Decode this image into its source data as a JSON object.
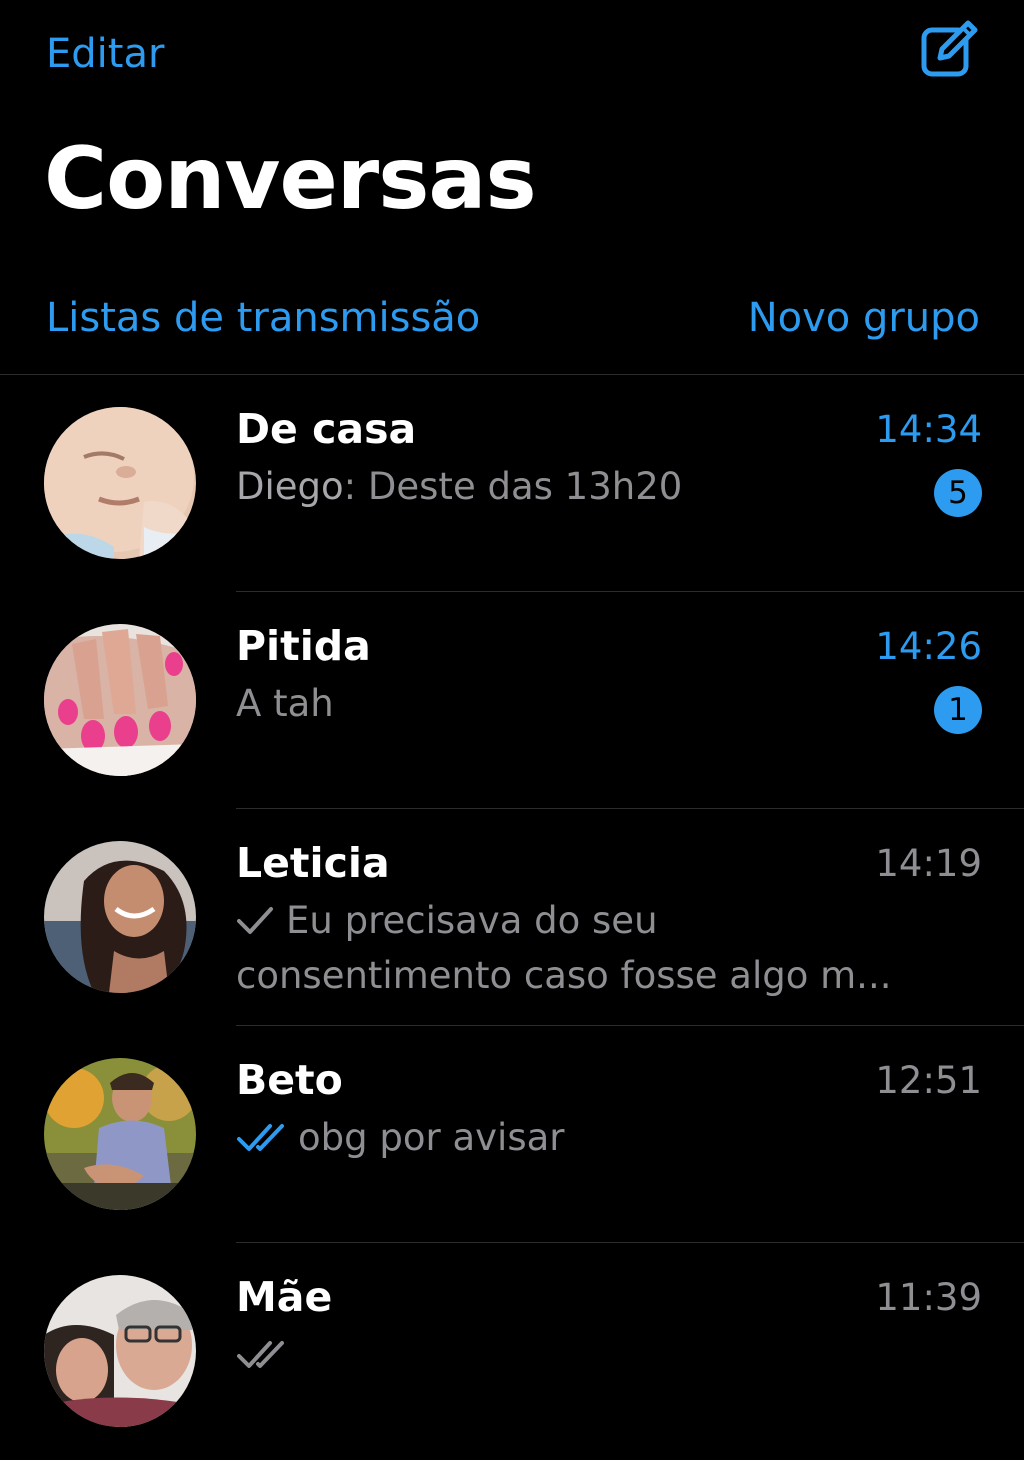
{
  "colors": {
    "accent": "#2d9cf0",
    "background": "#000000",
    "secondary_text": "#8e8e93",
    "divider": "#2c2c2e"
  },
  "header": {
    "edit_label": "Editar",
    "compose_icon": "compose-icon",
    "title": "Conversas",
    "broadcast_label": "Listas de transmissão",
    "new_group_label": "Novo grupo"
  },
  "chats": [
    {
      "name": "De casa",
      "time": "14:34",
      "unread": true,
      "badge": "5",
      "sender": "Diego",
      "preview": ": Deste das 13h20",
      "status_icon": "",
      "avatar_icon": "baby-photo-avatar"
    },
    {
      "name": "Pitida",
      "time": "14:26",
      "unread": true,
      "badge": "1",
      "sender": "",
      "preview": "A tah",
      "status_icon": "",
      "avatar_icon": "painted-nails-avatar"
    },
    {
      "name": "Leticia",
      "time": "14:19",
      "unread": false,
      "badge": "",
      "sender": "",
      "preview": "Eu precisava do seu consentimento caso fosse algo m...",
      "status_icon": "single-check-icon",
      "avatar_icon": "woman-smiling-avatar"
    },
    {
      "name": "Beto",
      "time": "12:51",
      "unread": false,
      "badge": "",
      "sender": "",
      "preview": "obg por avisar",
      "status_icon": "double-check-read-icon",
      "avatar_icon": "man-outdoors-avatar"
    },
    {
      "name": "Mãe",
      "time": "11:39",
      "unread": false,
      "badge": "",
      "sender": "",
      "preview": "",
      "status_icon": "double-check-icon",
      "avatar_icon": "couple-photo-avatar"
    }
  ]
}
